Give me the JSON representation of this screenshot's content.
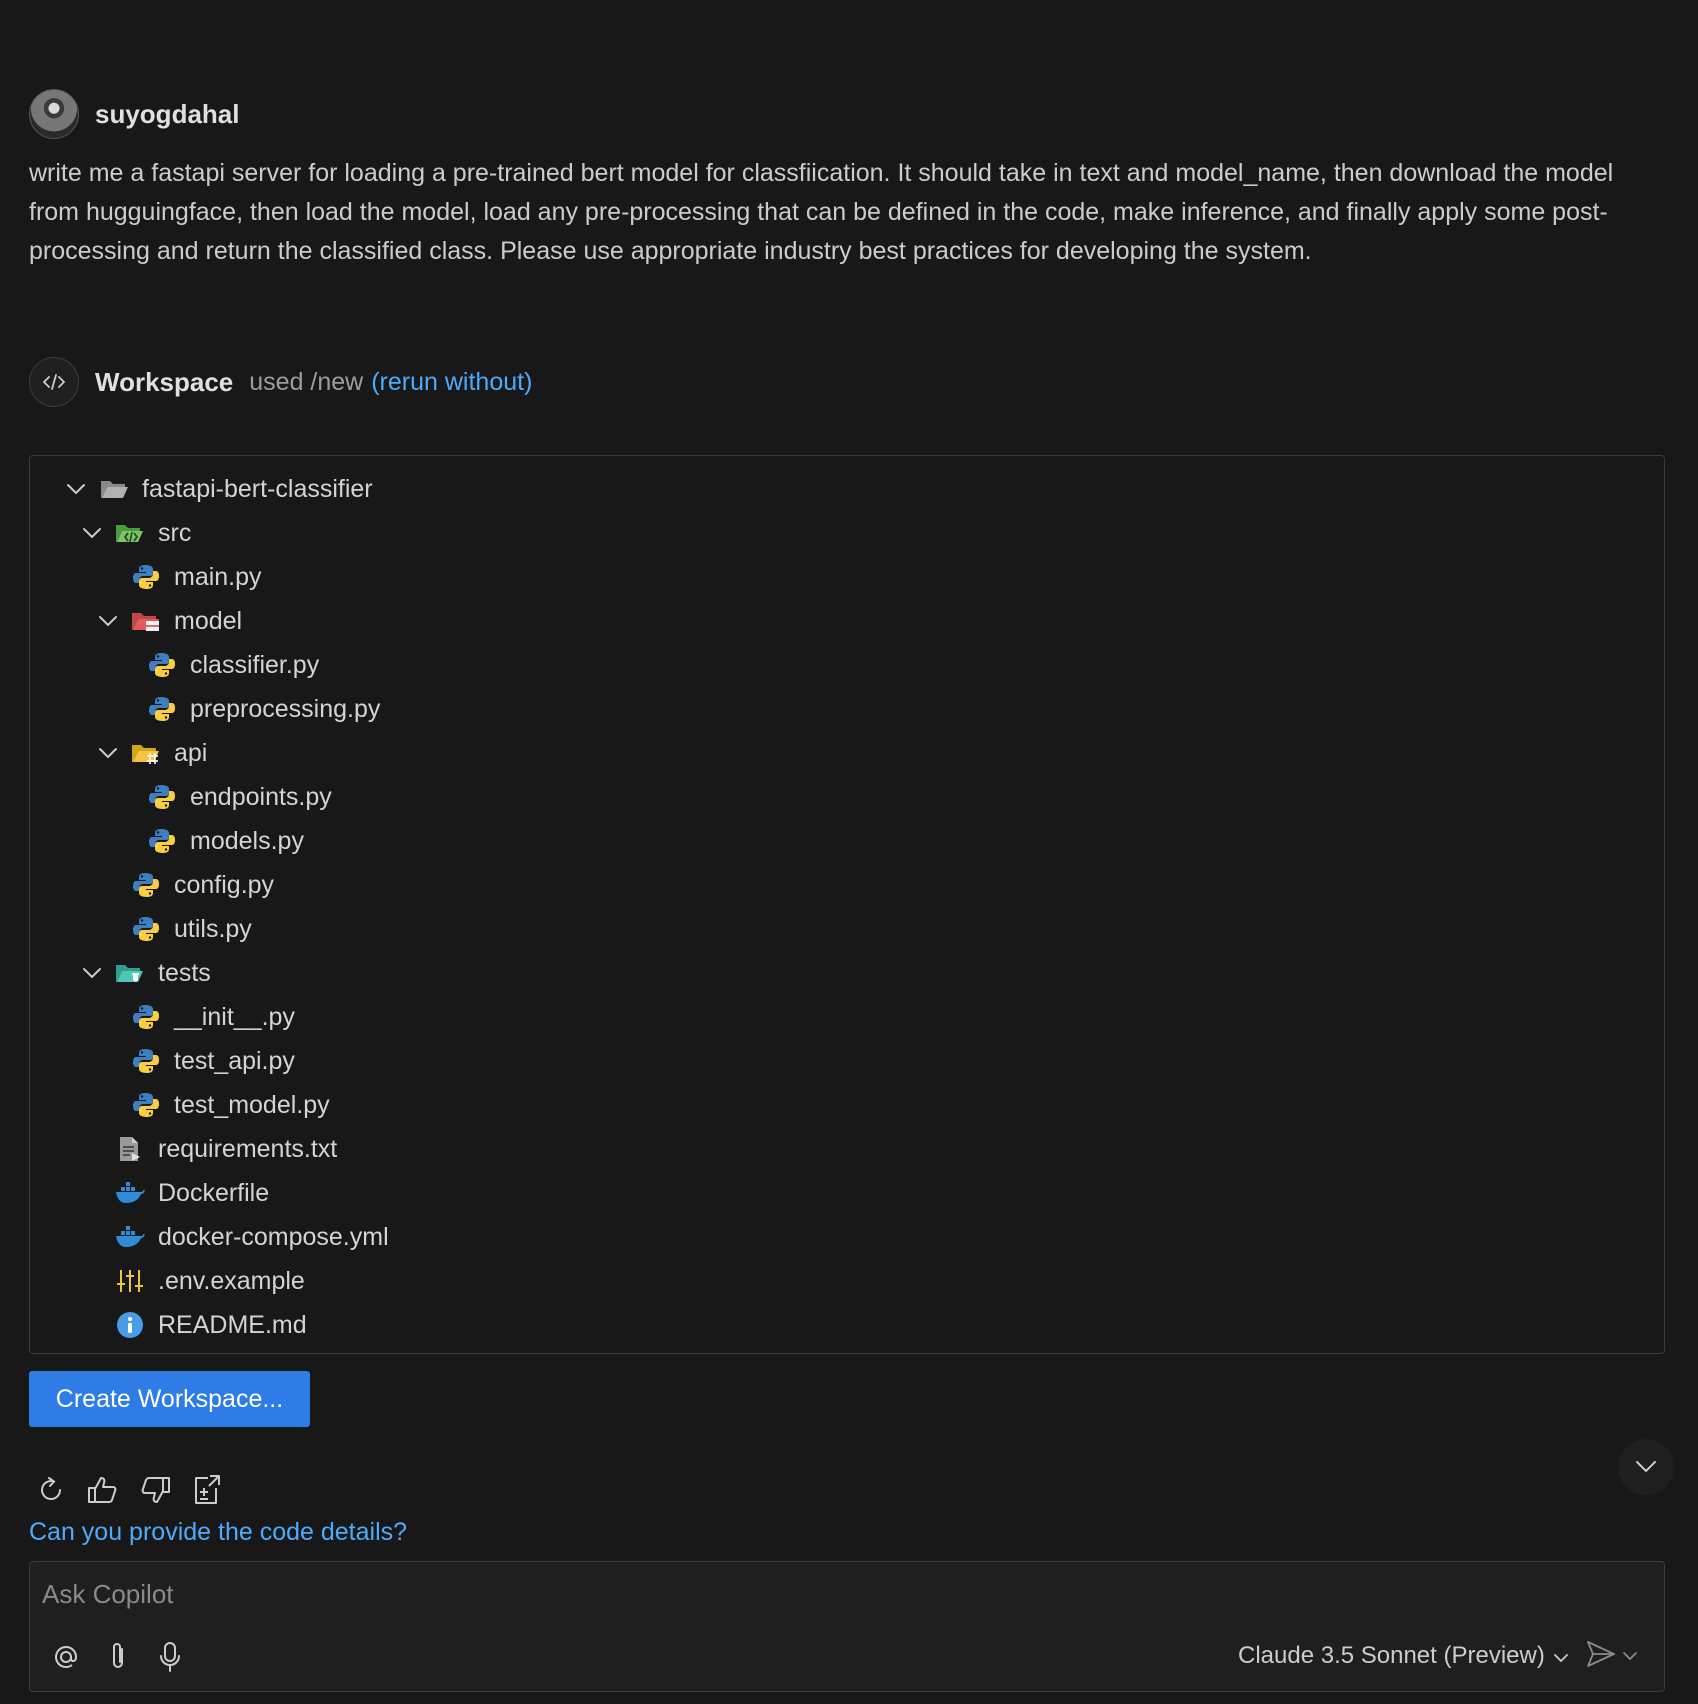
{
  "user": {
    "name": "suyogdahal",
    "message": "write me a fastapi server for loading a pre-trained bert model for classfiication. It should take in text and model_name, then download the model from hugguingface, then load the model, load any pre-processing that can be defined in the code, make inference, and finally apply some post-processing and return the classified class. Please use appropriate industry best practices for developing the system."
  },
  "workspace": {
    "name": "Workspace",
    "used_text": "used /new",
    "rerun_label": "(rerun without)"
  },
  "tree": {
    "root": "fastapi-bert-classifier",
    "src": "src",
    "main": "main.py",
    "model": "model",
    "classifier": "classifier.py",
    "preprocessing": "preprocessing.py",
    "api": "api",
    "endpoints": "endpoints.py",
    "models": "models.py",
    "config": "config.py",
    "utils": "utils.py",
    "tests": "tests",
    "init": "__init__.py",
    "test_api": "test_api.py",
    "test_model": "test_model.py",
    "requirements": "requirements.txt",
    "dockerfile": "Dockerfile",
    "compose": "docker-compose.yml",
    "env": ".env.example",
    "readme": "README.md"
  },
  "create_button": "Create Workspace...",
  "followup": "Can you provide the code details?",
  "chat": {
    "placeholder": "Ask Copilot",
    "model": "Claude 3.5 Sonnet (Preview)"
  },
  "colors": {
    "accent_blue": "#4daafc",
    "button_blue": "#2e7ce6",
    "python_blue": "#3d7fc1",
    "python_yellow": "#f7ce46",
    "docker_blue": "#2f8bd6"
  }
}
